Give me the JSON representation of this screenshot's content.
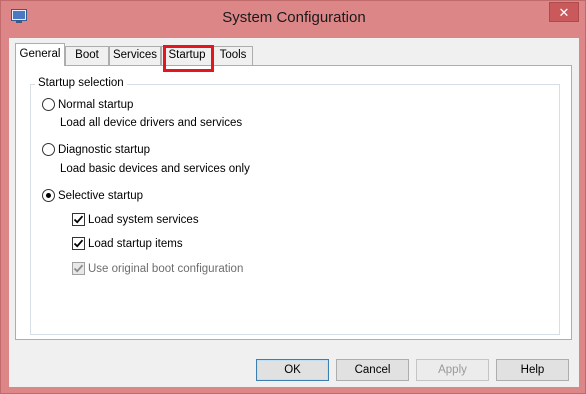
{
  "window": {
    "title": "System Configuration",
    "close_glyph": "✕",
    "icon": "system-config-icon"
  },
  "tabs": [
    {
      "label": "General",
      "active": true
    },
    {
      "label": "Boot",
      "active": false
    },
    {
      "label": "Services",
      "active": false
    },
    {
      "label": "Startup",
      "active": false,
      "highlighted": true
    },
    {
      "label": "Tools",
      "active": false
    }
  ],
  "startup_selection": {
    "legend": "Startup selection",
    "normal": {
      "label": "Normal startup",
      "description": "Load all device drivers and services",
      "selected": false
    },
    "diagnostic": {
      "label": "Diagnostic startup",
      "description": "Load basic devices and services only",
      "selected": false
    },
    "selective": {
      "label": "Selective startup",
      "selected": true,
      "load_system_services": {
        "label": "Load system services",
        "checked": true
      },
      "load_startup_items": {
        "label": "Load startup items",
        "checked": true
      },
      "use_original_boot": {
        "label": "Use original boot configuration",
        "checked": true,
        "disabled": true
      }
    }
  },
  "buttons": {
    "ok": "OK",
    "cancel": "Cancel",
    "apply": "Apply",
    "help": "Help"
  },
  "colors": {
    "highlight": "#e3151f",
    "title_bar": "#dd8688"
  }
}
